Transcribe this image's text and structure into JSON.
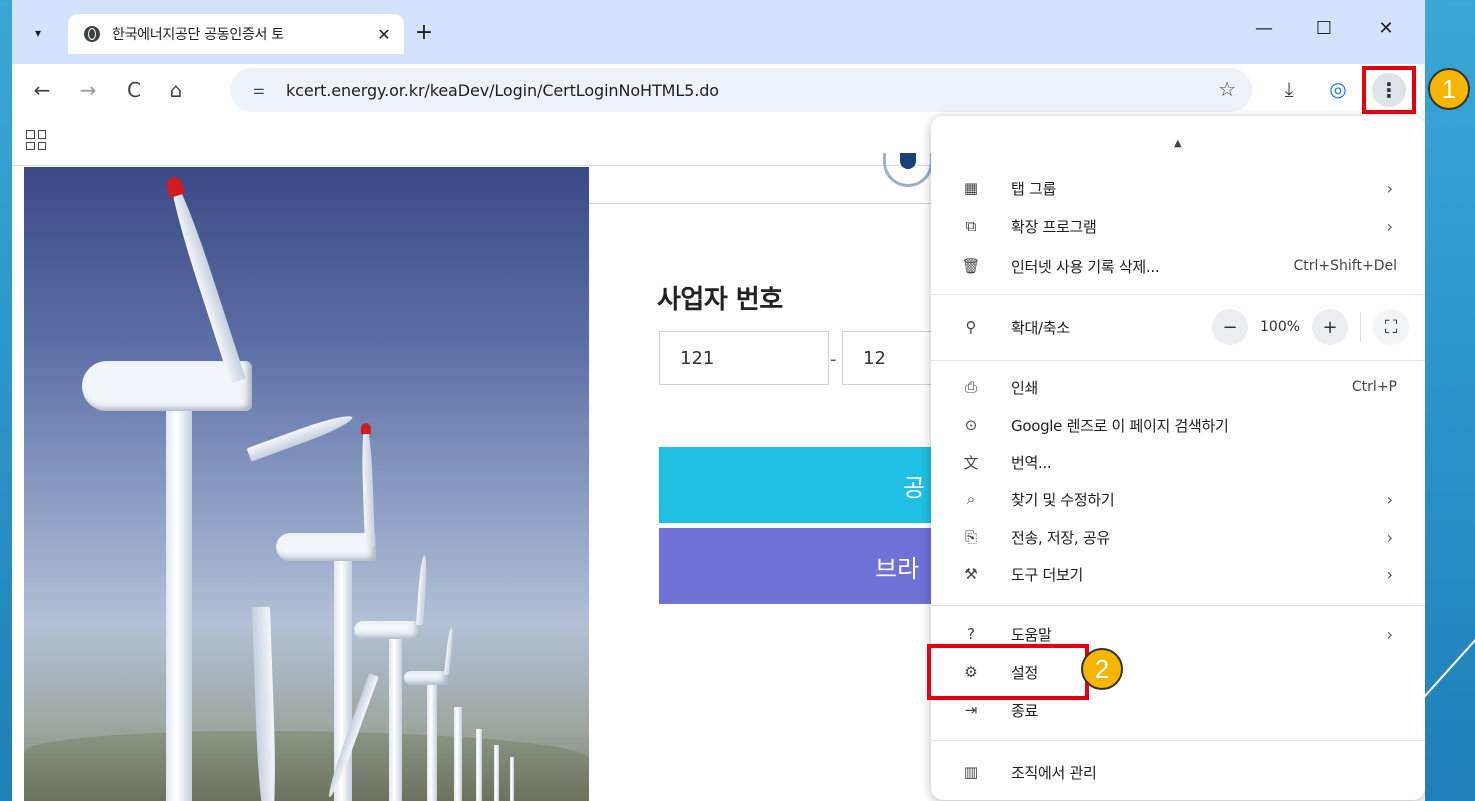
{
  "tab": {
    "title": "한국에너지공단 공동인증서 토",
    "close": "✕",
    "new_tab": "+"
  },
  "window": {
    "minimize": "—",
    "maximize": "☐",
    "close": "✕"
  },
  "toolbar": {
    "back": "←",
    "forward": "→",
    "reload": "C",
    "home": "⌂",
    "url": "kcert.energy.or.kr/keaDev/Login/CertLoginNoHTML5.do",
    "bookmark_star": "☆",
    "download": "⤓",
    "profile": "◎",
    "kebab": "⋮"
  },
  "page": {
    "biz_label": "사업자 번호",
    "biz_part1": "121",
    "biz_part2": "12",
    "dash": "-",
    "btn_cert_visible": "공",
    "btn_browser_visible": "브라"
  },
  "menu": {
    "items": [
      {
        "icon": "tab-groups-icon",
        "glyph": "▦",
        "label": "탭 그룹",
        "arrow": "›"
      },
      {
        "icon": "extensions-icon",
        "glyph": "⧉",
        "label": "확장 프로그램",
        "arrow": "›"
      },
      {
        "icon": "trash-icon",
        "glyph": "🗑",
        "label": "인터넷 사용 기록 삭제...",
        "shortcut": "Ctrl+Shift+Del"
      },
      {
        "icon": "zoom-icon",
        "glyph": "⚲",
        "label": "확대/축소"
      },
      {
        "icon": "print-icon",
        "glyph": "⎙",
        "label": "인쇄",
        "shortcut": "Ctrl+P"
      },
      {
        "icon": "lens-icon",
        "glyph": "⊙",
        "label": "Google 렌즈로 이 페이지 검색하기"
      },
      {
        "icon": "translate-icon",
        "glyph": "文",
        "label": "번역..."
      },
      {
        "icon": "find-icon",
        "glyph": "⌕",
        "label": "찾기 및 수정하기",
        "arrow": "›"
      },
      {
        "icon": "share-icon",
        "glyph": "⎘",
        "label": "전송, 저장, 공유",
        "arrow": "›"
      },
      {
        "icon": "tools-icon",
        "glyph": "⚒",
        "label": "도구 더보기",
        "arrow": "›"
      },
      {
        "icon": "help-icon",
        "glyph": "?",
        "label": "도움말",
        "arrow": "›"
      },
      {
        "icon": "gear-icon",
        "glyph": "⚙",
        "label": "설정"
      },
      {
        "icon": "exit-icon",
        "glyph": "⇥",
        "label": "종료"
      },
      {
        "icon": "managed-icon",
        "glyph": "▥",
        "label": "조직에서 관리"
      }
    ],
    "zoom": {
      "minus": "−",
      "value": "100%",
      "plus": "+",
      "fullscreen": "⛶"
    }
  },
  "annotations": {
    "badge1": "1",
    "badge2": "2"
  },
  "colors": {
    "highlight": "#e60012",
    "badge": "#f7b500",
    "cert_button": "#1fc0e4",
    "browser_button": "#6f73d8"
  }
}
